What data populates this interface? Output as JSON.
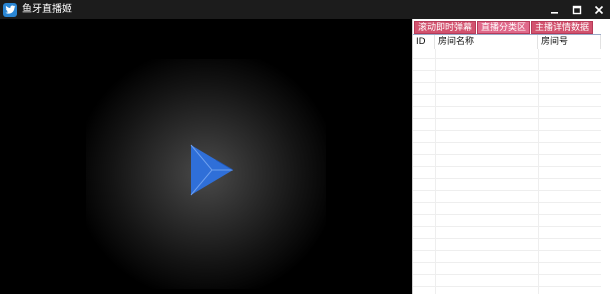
{
  "window": {
    "title": "鱼牙直播姬",
    "app_icon": "bird-icon",
    "controls": [
      "minimize-icon",
      "maximize-icon",
      "close-icon"
    ]
  },
  "player": {
    "play_icon": "play-icon",
    "accent": "#2f6fd8"
  },
  "side": {
    "tabs": [
      {
        "label": "滚动即时弹幕"
      },
      {
        "label": "直播分类区"
      },
      {
        "label": "主播详情数据"
      }
    ],
    "active_tab": "直播分类区",
    "table": {
      "columns": [
        "ID",
        "房间名称",
        "房间号"
      ],
      "rows": []
    }
  },
  "colors": {
    "titlebar": "#1c1c1c",
    "tab": "#d2526e",
    "play": "#2f6fd8"
  }
}
